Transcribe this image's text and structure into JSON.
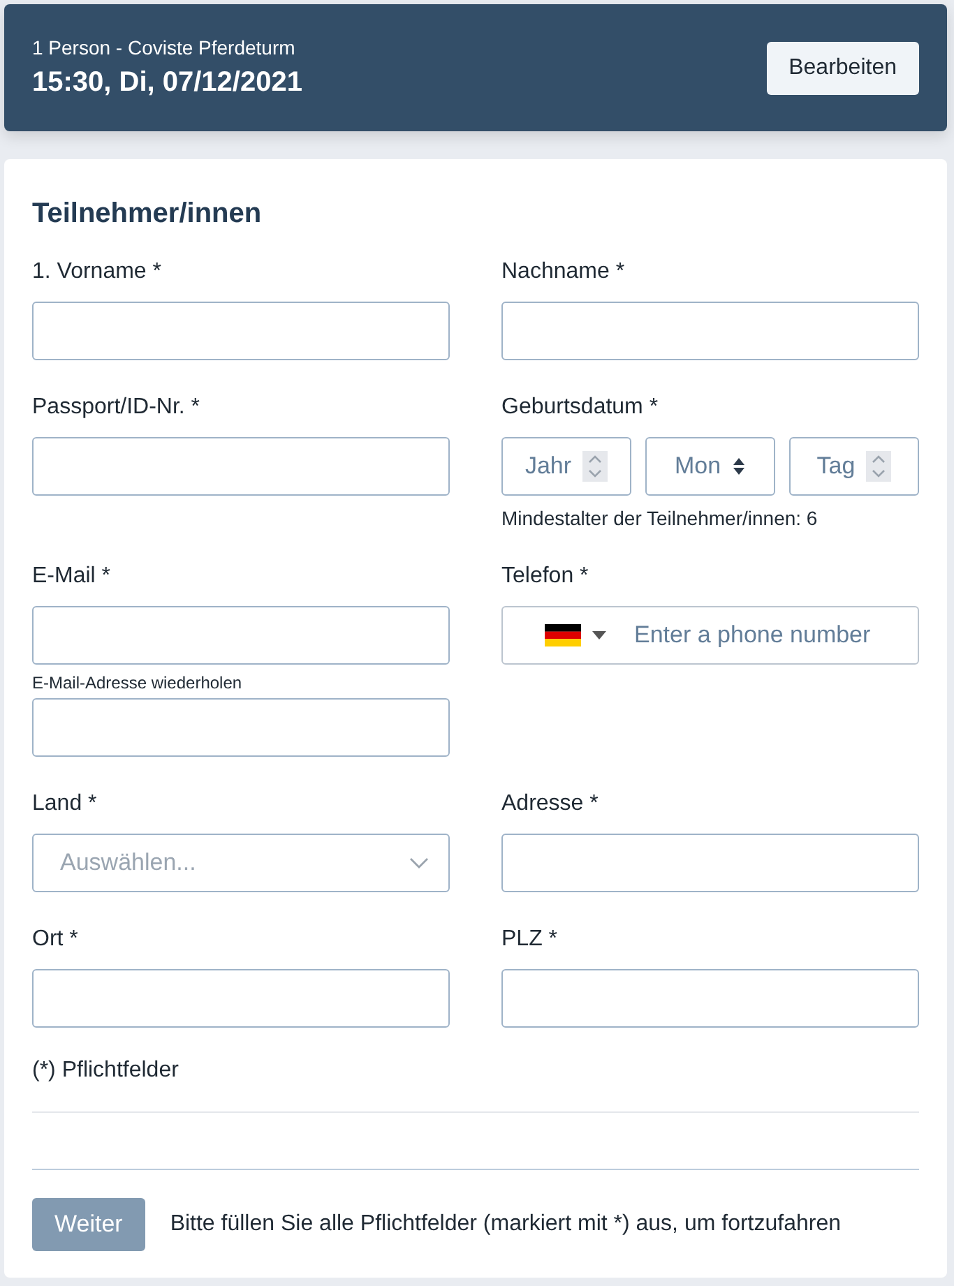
{
  "header": {
    "subtitle": "1 Person - Coviste Pferdeturm",
    "datetime": "15:30, Di, 07/12/2021",
    "button": "Bearbeiten"
  },
  "section_title": "Teilnehmer/innen",
  "fields": [
    {
      "kind": "text",
      "label": "1. Vorname *"
    },
    {
      "kind": "text",
      "label": "Nachname *"
    },
    {
      "kind": "text",
      "label": "Passport/ID-Nr. *"
    },
    {
      "kind": "date",
      "label": "Geburtsdatum *",
      "parts": [
        {
          "kind": "spinner",
          "placeholder": "Jahr"
        },
        {
          "kind": "select",
          "placeholder": "Mon"
        },
        {
          "kind": "spinner",
          "placeholder": "Tag"
        }
      ],
      "hint": "Mindestalter der Teilnehmer/innen: 6"
    },
    {
      "kind": "text",
      "label": "E-Mail *",
      "repeat_label": "E-Mail-Adresse wiederholen"
    },
    {
      "kind": "phone",
      "label": "Telefon *",
      "placeholder": "Enter a phone number"
    },
    {
      "kind": "select",
      "label": "Land *",
      "placeholder": "Auswählen..."
    },
    {
      "kind": "text",
      "label": "Adresse *"
    },
    {
      "kind": "text",
      "label": "Ort *"
    },
    {
      "kind": "text",
      "label": "PLZ *"
    }
  ],
  "required_note": "(*) Pflichtfelder",
  "footer": {
    "button": {
      "label": "Weiter",
      "disabled": true
    },
    "message": "Bitte füllen Sie alle Pflichtfelder (markiert mit *) aus, um fortzufahren"
  }
}
